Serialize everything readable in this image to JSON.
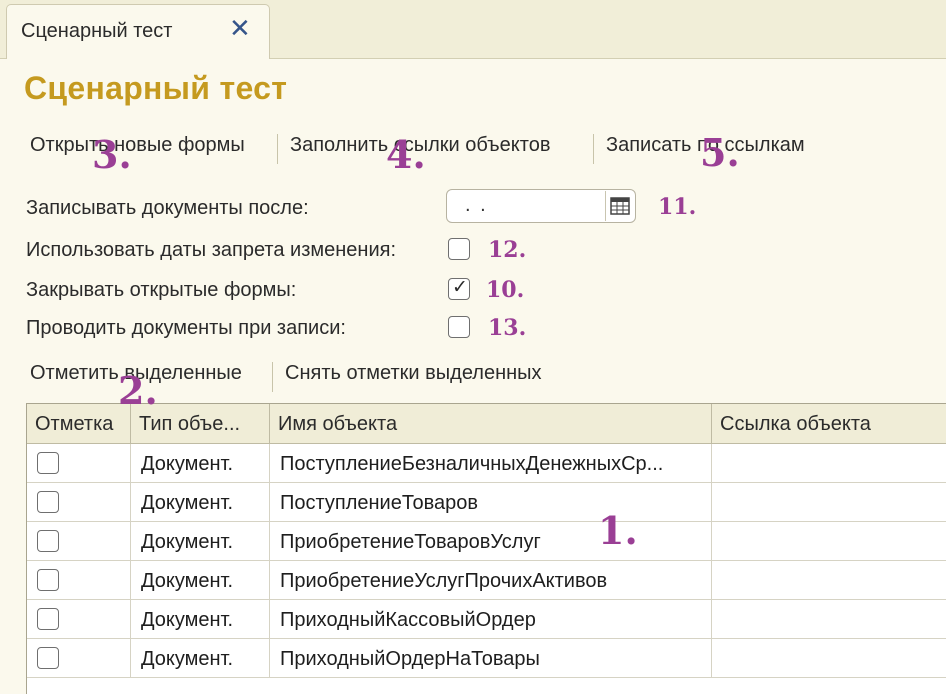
{
  "tab": {
    "label": "Сценарный тест",
    "close": "✕"
  },
  "page_title": "Сценарный тест",
  "toolbar": {
    "open_new_forms": "Открыть новые формы",
    "fill_object_links": "Заполнить ссылки объектов",
    "write_by_links": "Записать по ссылкам"
  },
  "fields": {
    "write_docs_after": {
      "label": "Записывать документы после:",
      "value": " .  ."
    },
    "use_prohibition_dates": {
      "label": "Использовать даты запрета изменения:",
      "checked": false
    },
    "close_open_forms": {
      "label": "Закрывать открытые формы:",
      "checked": true
    },
    "post_on_write": {
      "label": "Проводить документы при записи:",
      "checked": false
    }
  },
  "grid_toolbar": {
    "mark_selected": "Отметить выделенные",
    "unmark_selected": "Снять отметки выделенных"
  },
  "table": {
    "columns": [
      "Отметка",
      "Тип объе...",
      "Имя объекта",
      "Ссылка объекта"
    ],
    "rows": [
      {
        "checked": false,
        "type": "Документ.",
        "name": "ПоступлениеБезналичныхДенежныхСр...",
        "link": ""
      },
      {
        "checked": false,
        "type": "Документ.",
        "name": "ПоступлениеТоваров",
        "link": ""
      },
      {
        "checked": false,
        "type": "Документ.",
        "name": "ПриобретениеТоваровУслуг",
        "link": ""
      },
      {
        "checked": false,
        "type": "Документ.",
        "name": "ПриобретениеУслугПрочихАктивов",
        "link": ""
      },
      {
        "checked": false,
        "type": "Документ.",
        "name": "ПриходныйКассовыйОрдер",
        "link": ""
      },
      {
        "checked": false,
        "type": "Документ.",
        "name": "ПриходныйОрдерНаТовары",
        "link": ""
      }
    ]
  },
  "annotations": {
    "n1": "1.",
    "n2": "2.",
    "n3": "3.",
    "n4": "4.",
    "n5": "5.",
    "n10": "10.",
    "n11": "11.",
    "n12": "12.",
    "n13": "13."
  },
  "colors": {
    "title": "#c59a1f",
    "annotation": "#9a3f95",
    "tab_close": "#35558a",
    "background": "#fbf9ed"
  }
}
